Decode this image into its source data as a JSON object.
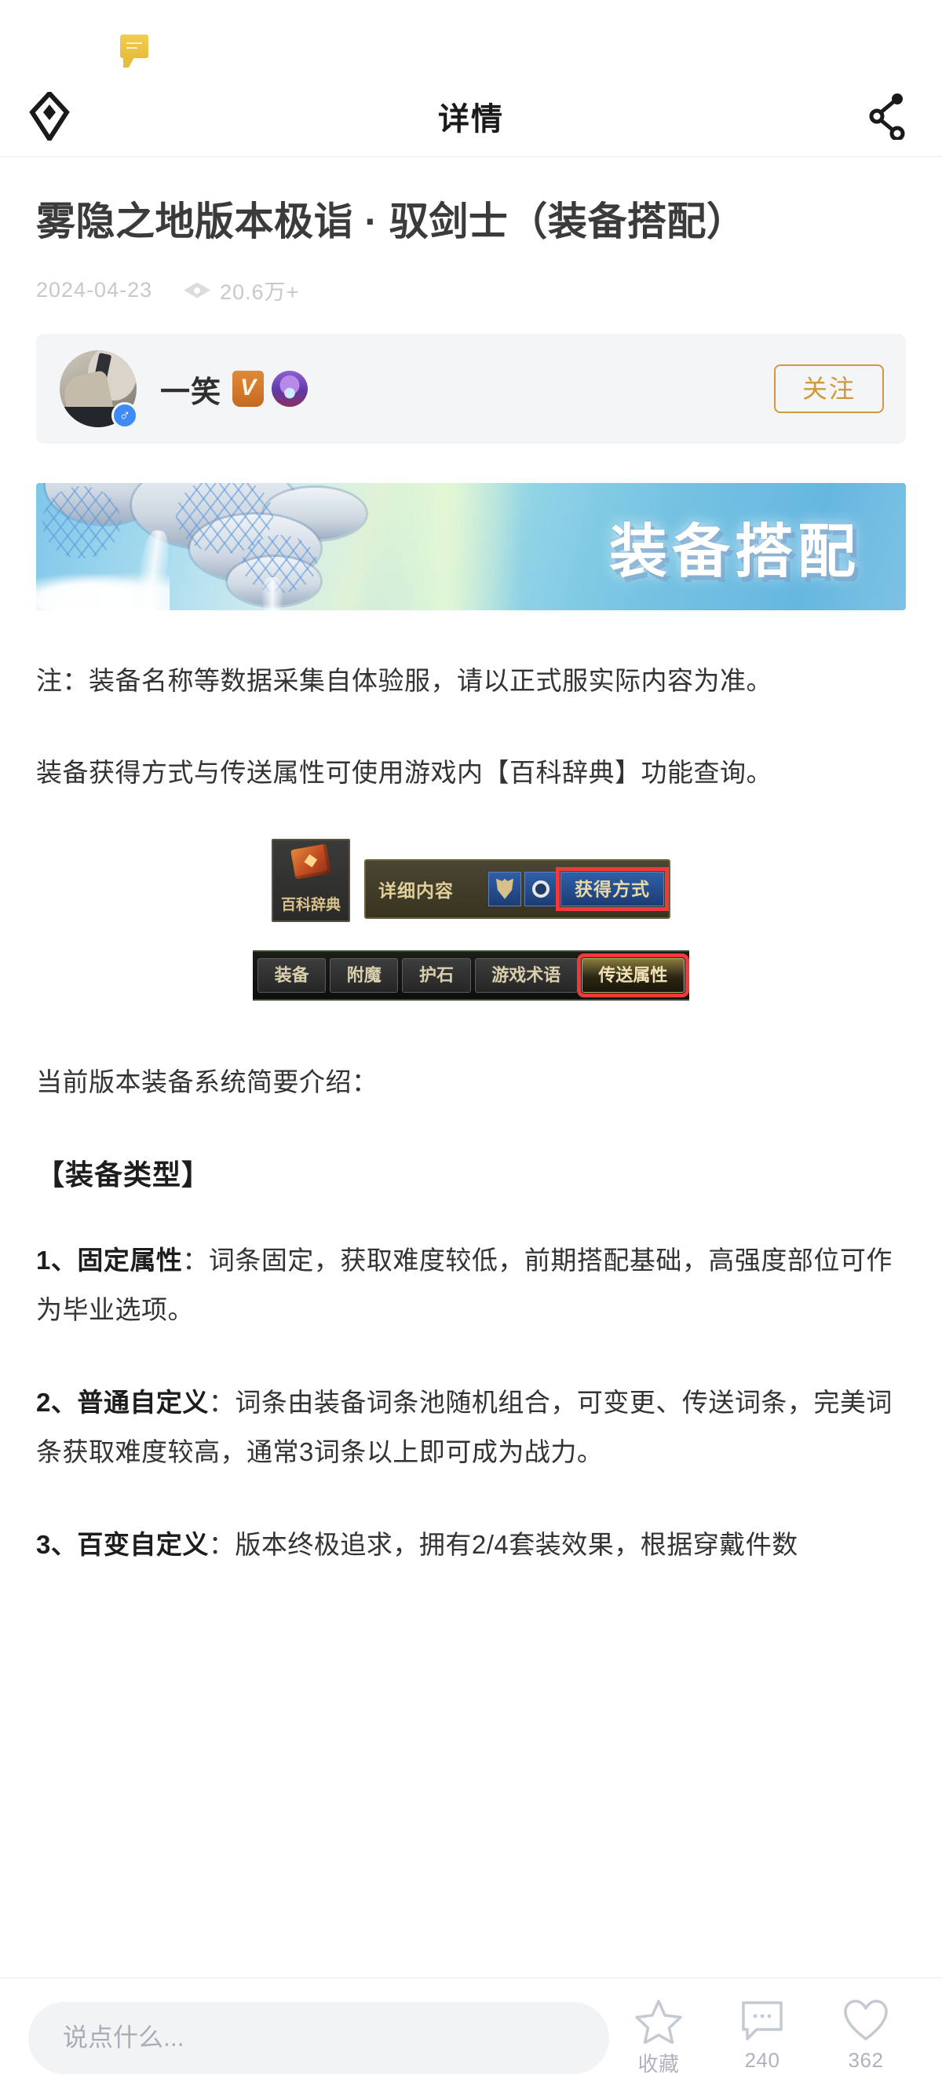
{
  "navbar": {
    "title": "详情",
    "back_icon": "back-diamond-icon",
    "share_icon": "share-icon"
  },
  "status": {
    "bubble_icon": "comment-bubble-icon"
  },
  "article": {
    "title": "雾隐之地版本极诣 · 驭剑士（装备搭配）",
    "date": "2024-04-23",
    "views": "20.6万+",
    "views_icon": "eye-icon"
  },
  "author": {
    "name": "一笑",
    "v_badge": "V",
    "emblem_icon": "guild-emblem-icon",
    "gender_icon": "male-icon",
    "follow_label": "关注"
  },
  "banner": {
    "text": "装备搭配"
  },
  "content": {
    "note": "注：装备名称等数据采集自体验服，请以正式服实际内容为准。",
    "dict_line": "装备获得方式与传送属性可使用游戏内【百科辞典】功能查询。",
    "intro": "当前版本装备系统简要介绍：",
    "section_heading": "【装备类型】",
    "item1_label": "1、固定属性",
    "item1_text": "：词条固定，获取难度较低，前期搭配基础，高强度部位可作为毕业选项。",
    "item2_label": "2、普通自定义",
    "item2_text": "：词条由装备词条池随机组合，可变更、传送词条，完美词条获取难度较高，通常3词条以上即可成为战力。",
    "item3_label": "3、百变自定义",
    "item3_text": "：版本终极追求，拥有2/4套装效果，根据穿戴件数"
  },
  "figure1": {
    "dict_tile_label": "百科辞典",
    "panel_title": "详细内容",
    "armor_icon": "armor-icon",
    "ring_icon": "ring-icon",
    "highlight_button": "获得方式"
  },
  "figure2": {
    "tabs": [
      {
        "label": "装备",
        "active": false
      },
      {
        "label": "附魔",
        "active": false
      },
      {
        "label": "护石",
        "active": false
      },
      {
        "label": "游戏术语",
        "active": false
      },
      {
        "label": "传送属性",
        "active": true
      }
    ]
  },
  "bottombar": {
    "input_placeholder": "说点什么...",
    "favorite": {
      "icon": "star-icon",
      "label": "收藏"
    },
    "comment": {
      "icon": "comment-icon",
      "count": "240"
    },
    "like": {
      "icon": "heart-icon",
      "count": "362"
    }
  },
  "colors": {
    "accent_gold": "#cf9a3c",
    "highlight_red": "#ee3a3a",
    "text_primary": "#333333",
    "text_muted": "#c8c8c8"
  }
}
